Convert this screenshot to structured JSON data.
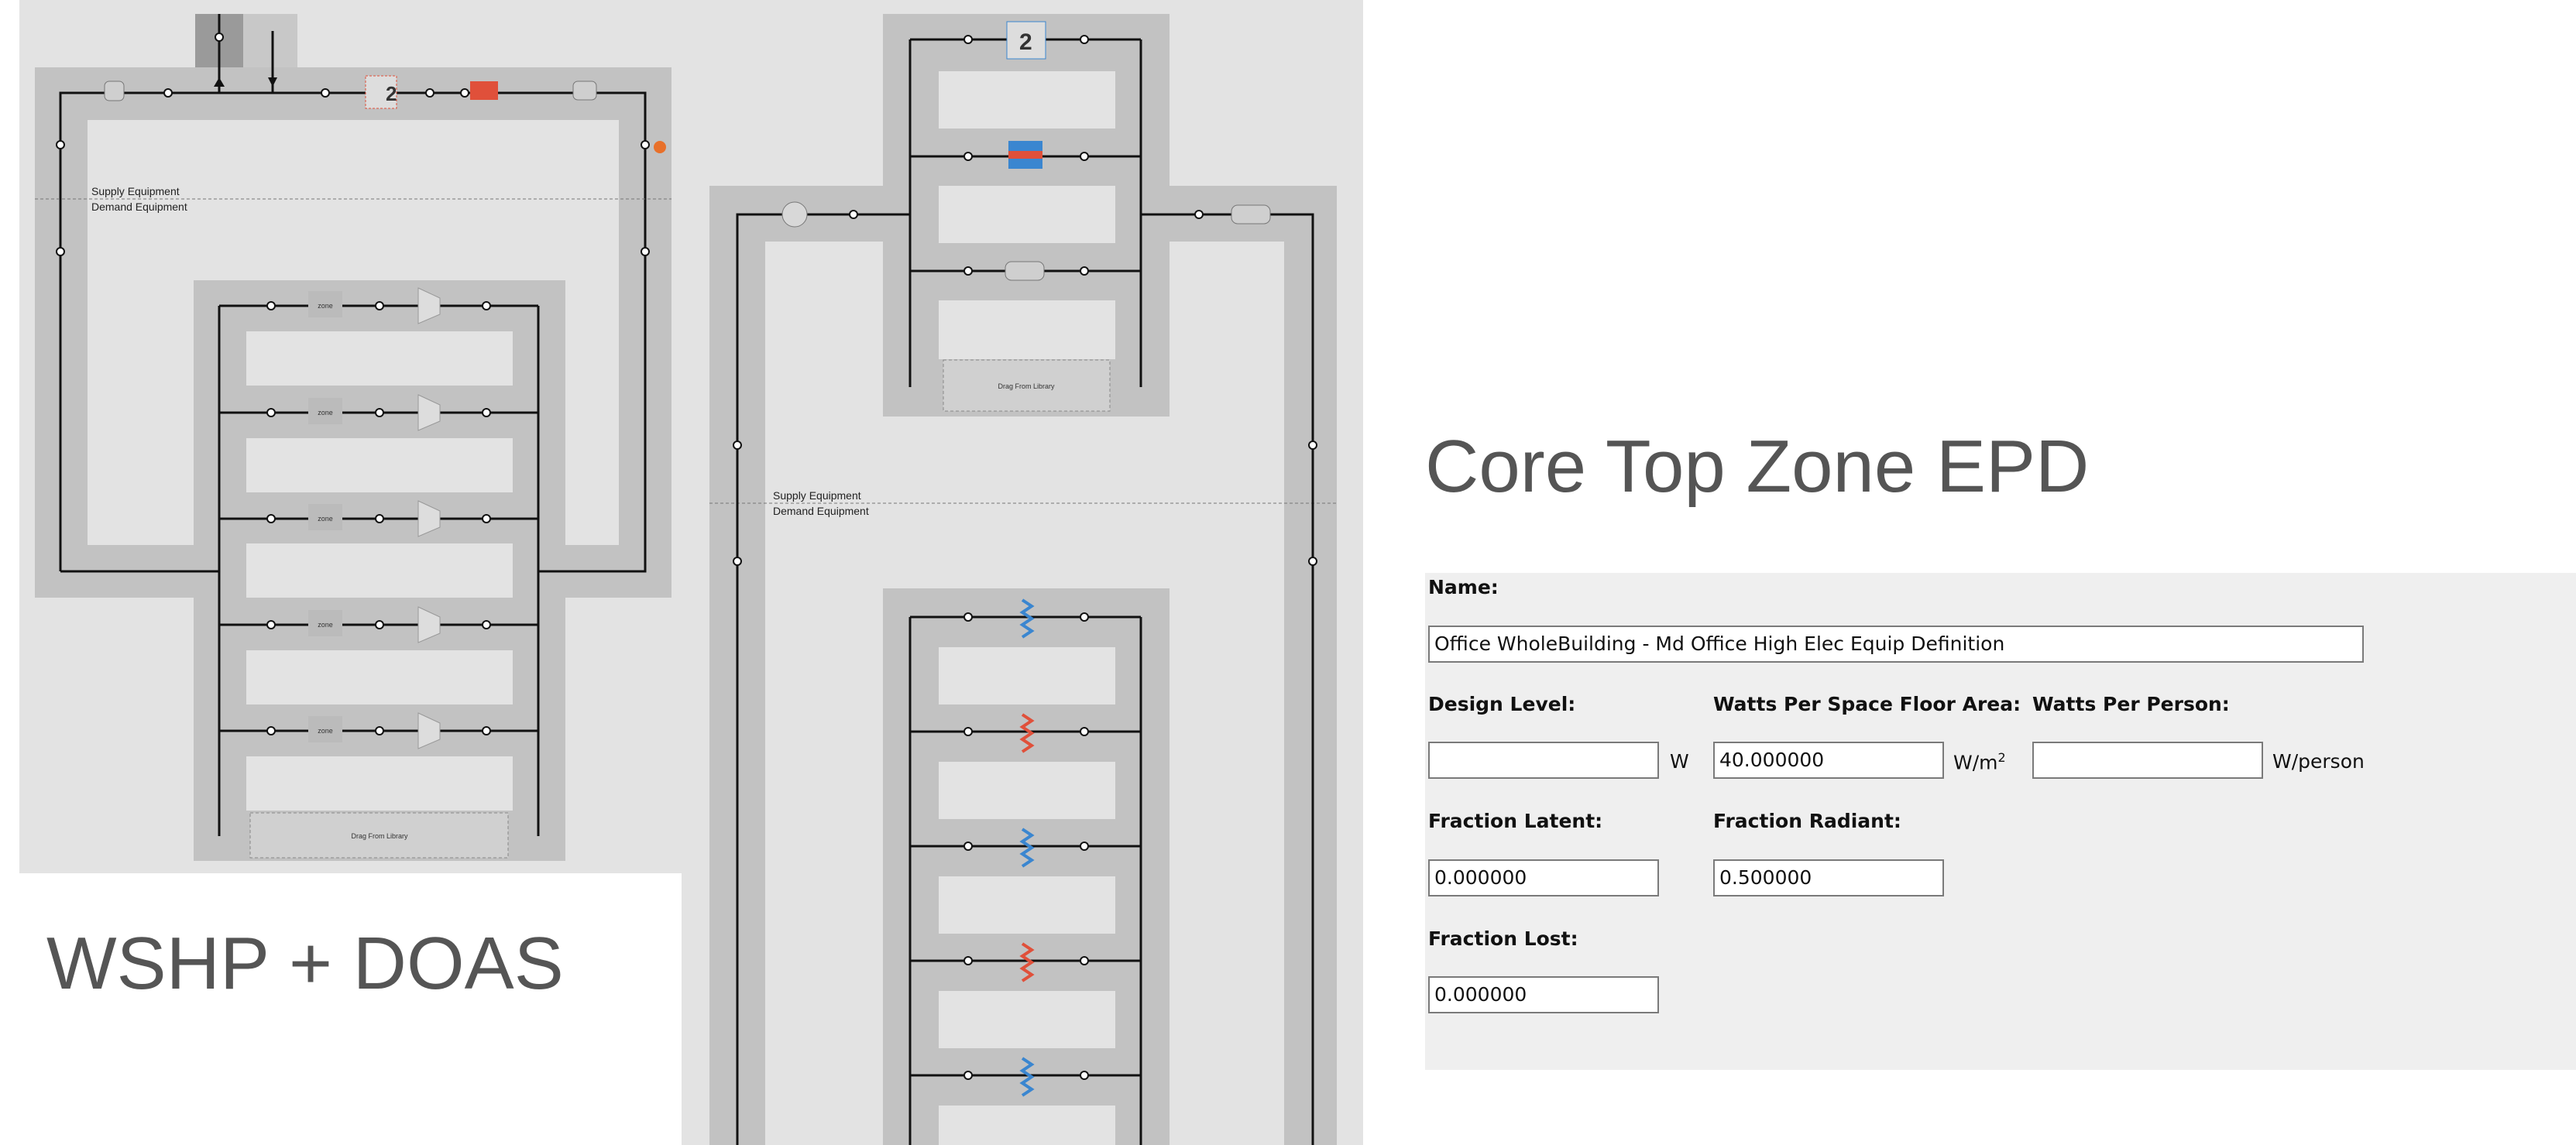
{
  "left_diagram": {
    "supply_label": "Supply Equipment",
    "demand_label": "Demand Equipment",
    "zone_label": "zone",
    "drop_label": "Drag From Library",
    "caption": "WSHP + DOAS"
  },
  "middle_diagram": {
    "supply_label": "Supply Equipment",
    "demand_label": "Demand Equipment",
    "drop_label": "Drag From Library"
  },
  "inspector": {
    "title": "Core Top Zone EPD",
    "name_label": "Name:",
    "name_value": "Office WholeBuilding - Md Office High Elec Equip Definition",
    "design_level_label": "Design Level:",
    "design_level_value": "",
    "design_level_unit": "W",
    "watts_area_label": "Watts Per Space Floor Area:",
    "watts_area_value": "40.000000",
    "watts_area_unit": "W/m",
    "watts_area_unit_sup": "2",
    "watts_person_label": "Watts Per Person:",
    "watts_person_value": "",
    "watts_person_unit": "W/person",
    "fraction_latent_label": "Fraction Latent:",
    "fraction_latent_value": "0.000000",
    "fraction_radiant_label": "Fraction Radiant:",
    "fraction_radiant_value": "0.500000",
    "fraction_lost_label": "Fraction Lost:",
    "fraction_lost_value": "0.000000"
  },
  "colors": {
    "canvas": "#e3e3e3",
    "loop_band": "#c2c2c2",
    "line": "#111111",
    "heating": "#e0503a",
    "cooling": "#3a86d0",
    "caption_text": "#555555"
  },
  "icons": [
    "air-terminal-icon",
    "zone-icon",
    "fan-icon",
    "cooling-coil-icon",
    "heating-coil-icon",
    "outdoor-air-system-icon",
    "heat-pump-coil-icon",
    "boiler-icon",
    "chiller-icon",
    "pump-icon",
    "pipe-icon",
    "remove-icon",
    "setpoint-manager-icon"
  ]
}
